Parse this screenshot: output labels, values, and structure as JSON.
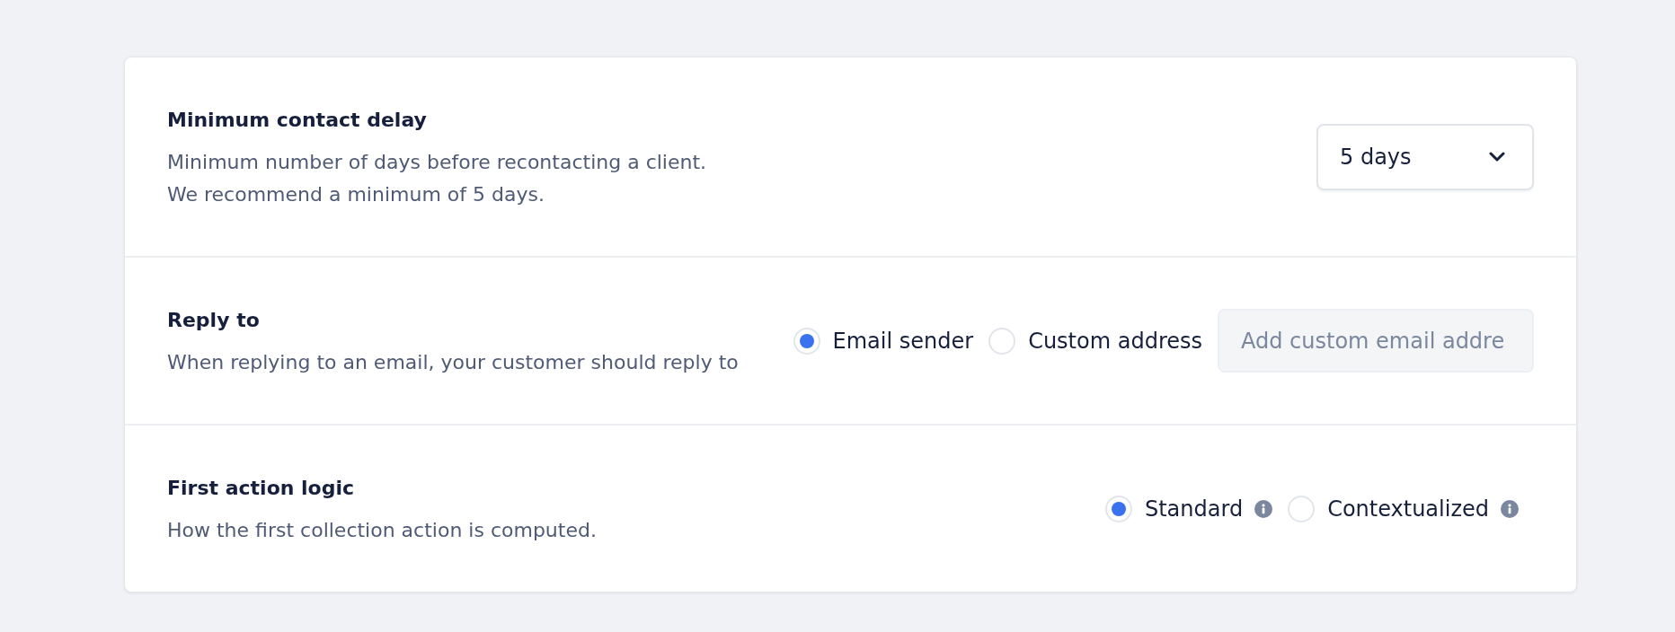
{
  "settings": [
    {
      "kind": "select",
      "title": "Minimum contact delay",
      "description": [
        "Minimum number of days before recontacting a client.",
        "We recommend a minimum of 5 days."
      ],
      "select": {
        "value": "5 days"
      }
    },
    {
      "kind": "radio",
      "title": "Reply to",
      "description": [
        "When replying to an email, your customer should reply to"
      ],
      "options": [
        {
          "label": "Email sender",
          "selected": true,
          "info": false
        },
        {
          "label": "Custom address",
          "selected": false,
          "info": false
        }
      ],
      "input": {
        "placeholder": "Add custom email addre"
      }
    },
    {
      "kind": "radio",
      "title": "First action logic",
      "description": [
        "How the first collection action is computed."
      ],
      "options": [
        {
          "label": "Standard",
          "selected": true,
          "info": true
        },
        {
          "label": "Contextualized",
          "selected": false,
          "info": true
        }
      ]
    }
  ]
}
